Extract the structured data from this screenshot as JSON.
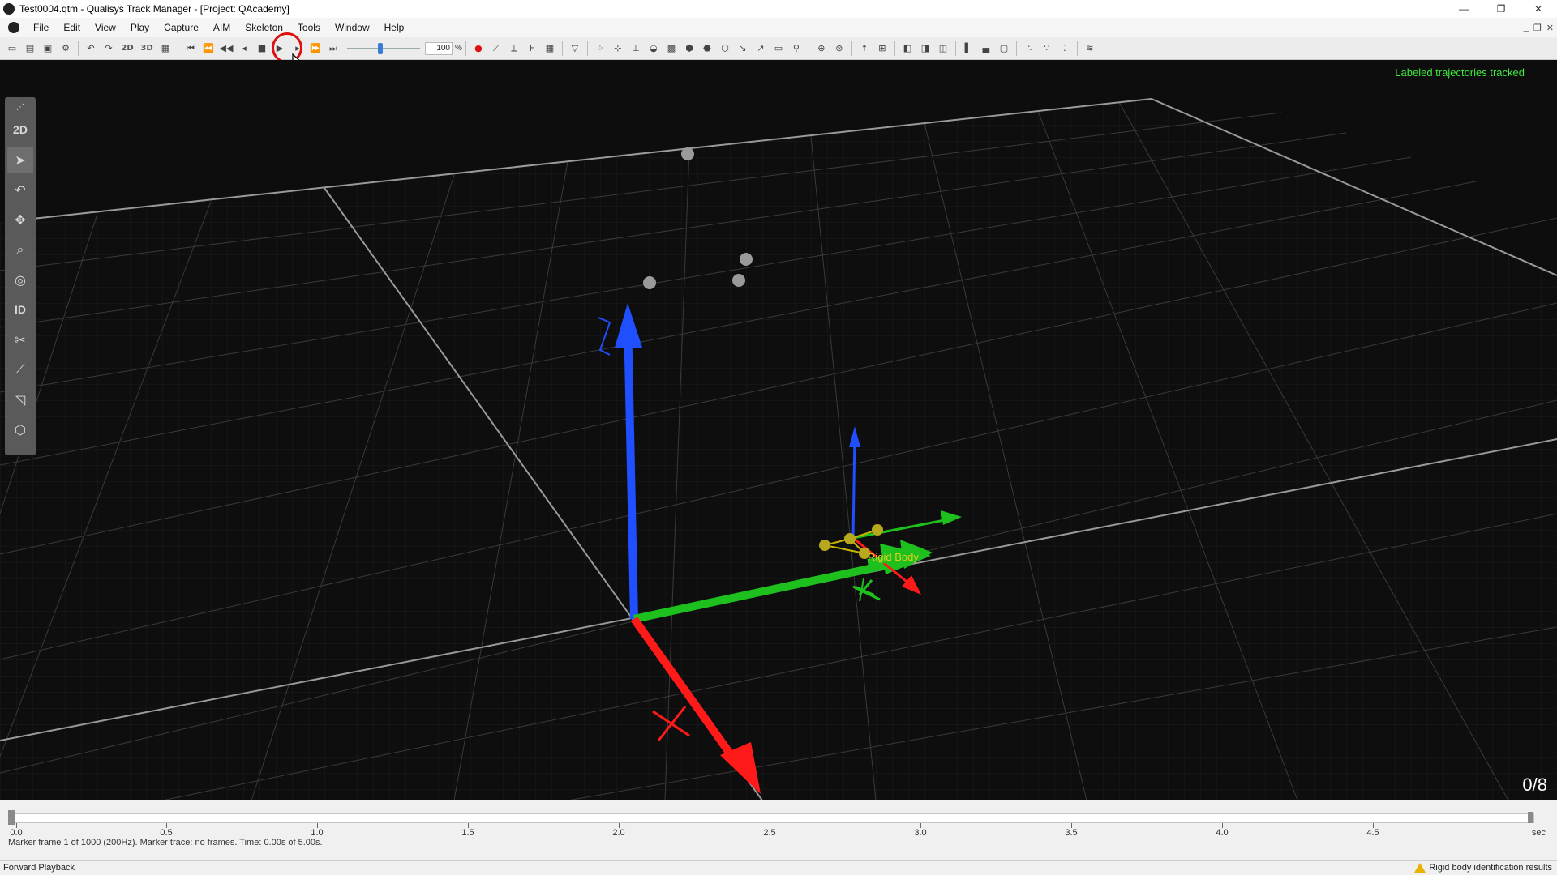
{
  "window": {
    "title": "Test0004.qtm - Qualisys Track Manager - [Project: QAcademy]",
    "controls": [
      "—",
      "❐",
      "✕"
    ]
  },
  "menu": [
    "File",
    "Edit",
    "View",
    "Play",
    "Capture",
    "AIM",
    "Skeleton",
    "Tools",
    "Window",
    "Help"
  ],
  "toolbar": {
    "label_2d": "2D",
    "label_3d": "3D",
    "speed_value": "100",
    "speed_unit": "%"
  },
  "viewport": {
    "status": "Labeled trajectories tracked",
    "frame_counter": "0/8",
    "rigid_body_label": "Rigid Body"
  },
  "left_tools": {
    "label_2d": "2D",
    "label_id": "ID"
  },
  "timeline": {
    "ticks": [
      "0.0",
      "0.5",
      "1.0",
      "1.5",
      "2.0",
      "2.5",
      "3.0",
      "3.5",
      "4.0",
      "4.5"
    ],
    "unit": "sec",
    "info": "Marker frame 1 of 1000 (200Hz). Marker trace: no frames. Time: 0.00s of 5.00s."
  },
  "statusbar": {
    "left": "Forward Playback",
    "right": "Rigid body identification results"
  },
  "colors": {
    "viewport_bg": "#0d0d0d",
    "status_green": "#41e841",
    "axis_red": "#ff1a1a",
    "axis_green": "#1ec01e",
    "axis_blue": "#1f4fff",
    "highlight": "#e01010"
  }
}
